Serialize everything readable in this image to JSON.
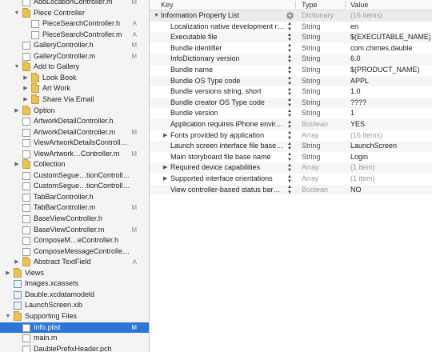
{
  "navigator": {
    "items": [
      {
        "label": "AddLocationController.m",
        "kind": "m",
        "depth": 2,
        "badge": "M",
        "disclosure": ""
      },
      {
        "label": "Piece Controller",
        "kind": "folder",
        "depth": 2,
        "badge": "",
        "disclosure": "open"
      },
      {
        "label": "PieceSearchController.h",
        "kind": "h",
        "depth": 3,
        "badge": "A",
        "disclosure": ""
      },
      {
        "label": "PieceSearchController.m",
        "kind": "m",
        "depth": 3,
        "badge": "A",
        "disclosure": ""
      },
      {
        "label": "GalleryController.h",
        "kind": "h",
        "depth": 2,
        "badge": "M",
        "disclosure": ""
      },
      {
        "label": "GalleryController.m",
        "kind": "m",
        "depth": 2,
        "badge": "M",
        "disclosure": ""
      },
      {
        "label": "Add to Gallery",
        "kind": "folder",
        "depth": 2,
        "badge": "",
        "disclosure": "open"
      },
      {
        "label": "Look Book",
        "kind": "folder",
        "depth": 3,
        "badge": "",
        "disclosure": "closed"
      },
      {
        "label": "Art Work",
        "kind": "folder",
        "depth": 3,
        "badge": "",
        "disclosure": "closed"
      },
      {
        "label": "Share Via Email",
        "kind": "folder",
        "depth": 3,
        "badge": "",
        "disclosure": "closed"
      },
      {
        "label": "Option",
        "kind": "folder",
        "depth": 2,
        "badge": "",
        "disclosure": "closed"
      },
      {
        "label": "ArtworkDetailController.h",
        "kind": "h",
        "depth": 2,
        "badge": "",
        "disclosure": ""
      },
      {
        "label": "ArtworkDetailController.m",
        "kind": "m",
        "depth": 2,
        "badge": "M",
        "disclosure": ""
      },
      {
        "label": "ViewArtworkDetailsController.h",
        "kind": "h",
        "depth": 2,
        "badge": "",
        "disclosure": ""
      },
      {
        "label": "ViewArtwork…Controller.m",
        "kind": "m",
        "depth": 2,
        "badge": "M",
        "disclosure": ""
      },
      {
        "label": "Collection",
        "kind": "folder",
        "depth": 2,
        "badge": "",
        "disclosure": "closed"
      },
      {
        "label": "CustomSegue…tionController.h",
        "kind": "h",
        "depth": 2,
        "badge": "",
        "disclosure": ""
      },
      {
        "label": "CustomSegue…tionController.m",
        "kind": "m",
        "depth": 2,
        "badge": "",
        "disclosure": ""
      },
      {
        "label": "TabBarController.h",
        "kind": "h",
        "depth": 2,
        "badge": "",
        "disclosure": ""
      },
      {
        "label": "TabBarController.m",
        "kind": "m",
        "depth": 2,
        "badge": "M",
        "disclosure": ""
      },
      {
        "label": "BaseViewController.h",
        "kind": "h",
        "depth": 2,
        "badge": "",
        "disclosure": ""
      },
      {
        "label": "BaseViewController.m",
        "kind": "m",
        "depth": 2,
        "badge": "M",
        "disclosure": ""
      },
      {
        "label": "ComposeM…eController.h",
        "kind": "h",
        "depth": 2,
        "badge": "",
        "disclosure": ""
      },
      {
        "label": "ComposeMessageController.m",
        "kind": "m",
        "depth": 2,
        "badge": "",
        "disclosure": ""
      },
      {
        "label": "Abstract TextField",
        "kind": "folder",
        "depth": 2,
        "badge": "A",
        "disclosure": "closed"
      },
      {
        "label": "Views",
        "kind": "folder",
        "depth": 1,
        "badge": "",
        "disclosure": "closed"
      },
      {
        "label": "Images.xcassets",
        "kind": "assets",
        "depth": 1,
        "badge": "",
        "disclosure": ""
      },
      {
        "label": "Dauble.xcdatamodeld",
        "kind": "data",
        "depth": 1,
        "badge": "",
        "disclosure": ""
      },
      {
        "label": "LaunchScreen.xib",
        "kind": "xib",
        "depth": 1,
        "badge": "",
        "disclosure": ""
      },
      {
        "label": "Supporting Files",
        "kind": "folder",
        "depth": 1,
        "badge": "",
        "disclosure": "open"
      },
      {
        "label": "Info.plist",
        "kind": "plist",
        "depth": 2,
        "badge": "M",
        "disclosure": "",
        "selected": true
      },
      {
        "label": "main.m",
        "kind": "m",
        "depth": 2,
        "badge": "",
        "disclosure": ""
      },
      {
        "label": "DaublePrefixHeader.pch",
        "kind": "pch",
        "depth": 2,
        "badge": "",
        "disclosure": ""
      }
    ]
  },
  "plist": {
    "headers": {
      "key": "Key",
      "type": "Type",
      "value": "Value"
    },
    "rows": [
      {
        "key": "Information Property List",
        "type": "Dictionary",
        "value": "(16 items)",
        "root": true,
        "disclosure": "open",
        "dim_type": true,
        "dim_value": true
      },
      {
        "key": "Localization native development r…",
        "type": "String",
        "value": "en"
      },
      {
        "key": "Executable file",
        "type": "String",
        "value": "$(EXECUTABLE_NAME)"
      },
      {
        "key": "Bundle identifier",
        "type": "String",
        "value": "com.chimes.dauble"
      },
      {
        "key": "InfoDictionary version",
        "type": "String",
        "value": "6.0"
      },
      {
        "key": "Bundle name",
        "type": "String",
        "value": "$(PRODUCT_NAME)"
      },
      {
        "key": "Bundle OS Type code",
        "type": "String",
        "value": "APPL"
      },
      {
        "key": "Bundle versions string, short",
        "type": "String",
        "value": "1.0"
      },
      {
        "key": "Bundle creator OS Type code",
        "type": "String",
        "value": "????"
      },
      {
        "key": "Bundle version",
        "type": "String",
        "value": "1"
      },
      {
        "key": "Application requires iPhone envir…",
        "type": "Boolean",
        "value": "YES",
        "dim_type": true
      },
      {
        "key": "Fonts provided by application",
        "type": "Array",
        "value": "(16 items)",
        "disclosure": "closed",
        "dim_type": true,
        "dim_value": true
      },
      {
        "key": "Launch screen interface file base…",
        "type": "String",
        "value": "LaunchScreen"
      },
      {
        "key": "Main storyboard file base name",
        "type": "String",
        "value": "Login"
      },
      {
        "key": "Required device capabilities",
        "type": "Array",
        "value": "(1 item)",
        "disclosure": "closed",
        "dim_type": true,
        "dim_value": true
      },
      {
        "key": "Supported interface orientations",
        "type": "Array",
        "value": "(1 item)",
        "disclosure": "closed",
        "dim_type": true,
        "dim_value": true
      },
      {
        "key": "View controller-based status bar…",
        "type": "Boolean",
        "value": "NO",
        "dim_type": true
      }
    ]
  },
  "icons": {
    "open": "▼",
    "closed": "▶",
    "stepper": "▲▼",
    "add": "+"
  },
  "colors": {
    "selection": "#2d76d9",
    "folder": "#e8c35a"
  }
}
